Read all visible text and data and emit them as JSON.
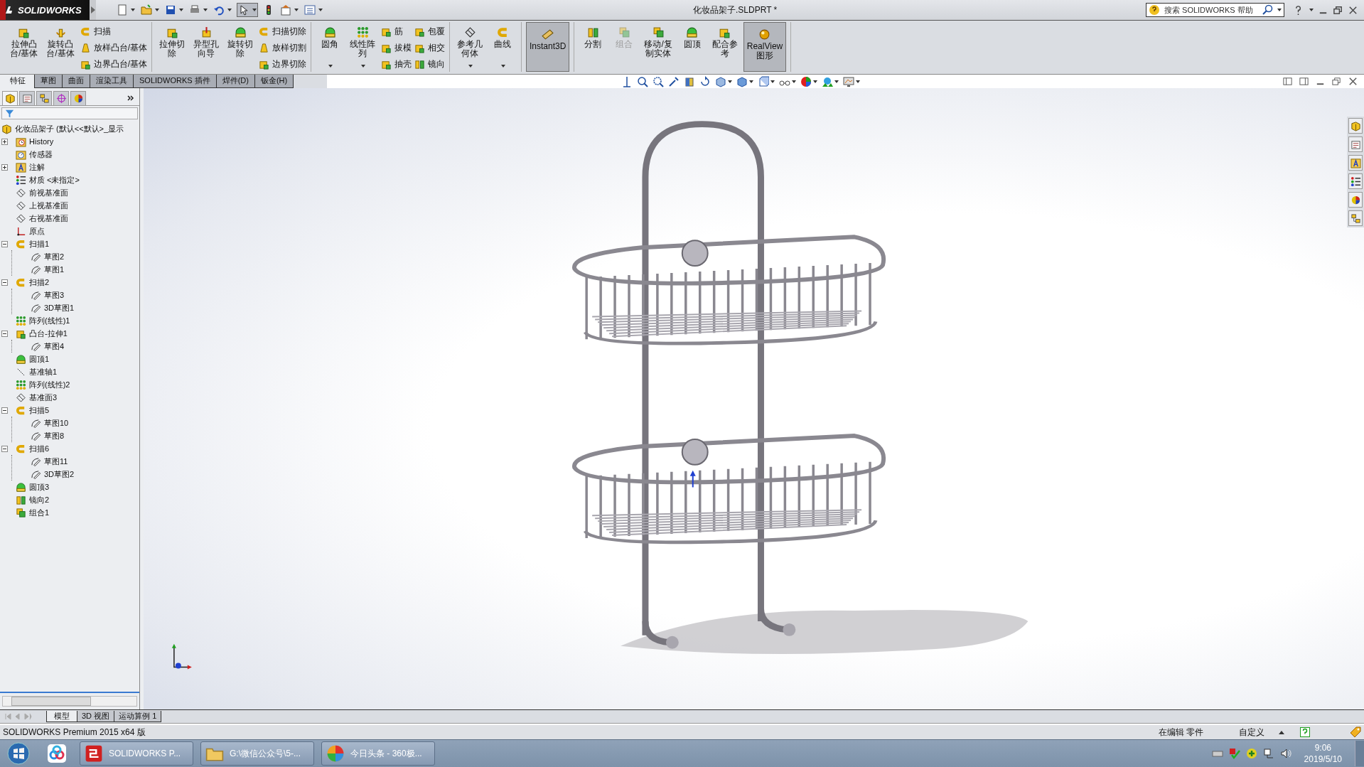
{
  "title_bar": {
    "brand": "SOLIDWORKS",
    "document_title": "化妆品架子.SLDPRT *",
    "search": {
      "placeholder": "搜索 SOLIDWORKS 帮助"
    }
  },
  "ribbon": {
    "groups": [
      [
        {
          "kind": "cube",
          "lines": [
            "拉伸凸",
            "台/基体"
          ],
          "selected": false,
          "disabled": false,
          "dropdown": false
        },
        {
          "kind": "revolve",
          "lines": [
            "旋转凸",
            "台/基体"
          ],
          "selected": false,
          "disabled": false,
          "dropdown": false
        },
        {
          "items": [
            {
              "label": "扫描",
              "kind": "sweep"
            },
            {
              "label": "放样凸台/基体",
              "kind": "bell"
            },
            {
              "label": "边界凸台/基体",
              "kind": "cube"
            }
          ]
        }
      ],
      [
        {
          "kind": "cube",
          "lines": [
            "拉伸切",
            "除"
          ],
          "selected": false,
          "disabled": false,
          "dropdown": false
        },
        {
          "kind": "drill",
          "lines": [
            "异型孔",
            "向导"
          ],
          "selected": false,
          "disabled": false,
          "dropdown": false
        },
        {
          "kind": "dome",
          "lines": [
            "旋转切",
            "除"
          ],
          "selected": false,
          "disabled": false,
          "dropdown": false
        },
        {
          "items": [
            {
              "label": "扫描切除",
              "kind": "sweep"
            },
            {
              "label": "放样切割",
              "kind": "bell"
            },
            {
              "label": "边界切除",
              "kind": "cube"
            }
          ]
        }
      ],
      [
        {
          "kind": "dome",
          "lines": [
            "圆角"
          ],
          "selected": false,
          "disabled": false,
          "dropdown": true
        },
        {
          "kind": "dots",
          "lines": [
            "线性阵",
            "列"
          ],
          "selected": false,
          "disabled": false,
          "dropdown": true
        },
        {
          "items": [
            {
              "label": "筋",
              "kind": "cube"
            },
            {
              "label": "拔模",
              "kind": "cube"
            },
            {
              "label": "抽壳",
              "kind": "cube"
            }
          ]
        },
        {
          "items": [
            {
              "label": "包覆",
              "kind": "cube"
            },
            {
              "label": "相交",
              "kind": "cube"
            },
            {
              "label": "镜向",
              "kind": "mirror"
            }
          ]
        }
      ],
      [
        {
          "kind": "plane",
          "lines": [
            "参考几",
            "何体"
          ],
          "selected": false,
          "disabled": false,
          "dropdown": true
        },
        {
          "kind": "sweep",
          "lines": [
            "曲线"
          ],
          "selected": false,
          "disabled": false,
          "dropdown": true
        }
      ],
      [
        {
          "kind": "ruler",
          "lines": [
            "Instant3D"
          ],
          "selected": true,
          "disabled": false,
          "dropdown": false
        }
      ],
      [
        {
          "kind": "mirror",
          "lines": [
            "分割"
          ],
          "selected": false,
          "disabled": false,
          "dropdown": false
        },
        {
          "kind": "combine",
          "lines": [
            "组合"
          ],
          "selected": false,
          "disabled": true,
          "dropdown": false
        },
        {
          "kind": "combine",
          "lines": [
            "移动/复",
            "制实体"
          ],
          "selected": false,
          "disabled": false,
          "dropdown": false
        },
        {
          "kind": "dome",
          "lines": [
            "圆顶"
          ],
          "selected": false,
          "disabled": false,
          "dropdown": false
        },
        {
          "kind": "cube",
          "lines": [
            "配合参",
            "考"
          ],
          "selected": false,
          "disabled": false,
          "dropdown": false
        },
        {
          "kind": "sphere",
          "lines": [
            "RealView",
            "图形"
          ],
          "selected": true,
          "disabled": false,
          "dropdown": false
        }
      ]
    ]
  },
  "command_tabs": [
    {
      "label": "特征",
      "selected": true
    },
    {
      "label": "草图",
      "selected": false
    },
    {
      "label": "曲面",
      "selected": false
    },
    {
      "label": "渲染工具",
      "selected": false
    },
    {
      "label": "SOLIDWORKS 插件",
      "selected": false
    },
    {
      "label": "焊件(D)",
      "selected": false
    },
    {
      "label": "钣金(H)",
      "selected": false
    }
  ],
  "panel_tabs": [
    {
      "kind": "part",
      "selected": true
    },
    {
      "kind": "property",
      "selected": false
    },
    {
      "kind": "config",
      "selected": false
    },
    {
      "kind": "target",
      "selected": false
    },
    {
      "kind": "pie",
      "selected": false
    }
  ],
  "feature_tree": {
    "root": {
      "label": "化妆品架子  (默认<<默认>_显示",
      "kind": "part"
    },
    "items": [
      {
        "label": "History",
        "kind": "history",
        "expanded": false
      },
      {
        "label": "传感器",
        "kind": "sensor"
      },
      {
        "label": "注解",
        "kind": "annotation",
        "expanded": false
      },
      {
        "label": "材质 <未指定>",
        "kind": "material"
      },
      {
        "label": "前视基准面",
        "kind": "plane"
      },
      {
        "label": "上视基准面",
        "kind": "plane"
      },
      {
        "label": "右视基准面",
        "kind": "plane"
      },
      {
        "label": "原点",
        "kind": "origin"
      },
      {
        "label": "扫描1",
        "kind": "sweep",
        "expanded": true,
        "children": [
          {
            "label": "草图2",
            "kind": "sketch"
          },
          {
            "label": "草图1",
            "kind": "sketch"
          }
        ]
      },
      {
        "label": "扫描2",
        "kind": "sweep",
        "expanded": true,
        "children": [
          {
            "label": "草图3",
            "kind": "sketch"
          },
          {
            "label": "3D草图1",
            "kind": "sketch"
          }
        ]
      },
      {
        "label": "阵列(线性)1",
        "kind": "dots"
      },
      {
        "label": "凸台-拉伸1",
        "kind": "cube",
        "expanded": true,
        "children": [
          {
            "label": "草图4",
            "kind": "sketch"
          }
        ]
      },
      {
        "label": "圆顶1",
        "kind": "dome"
      },
      {
        "label": "基准轴1",
        "kind": "axis"
      },
      {
        "label": "阵列(线性)2",
        "kind": "dots"
      },
      {
        "label": "基准面3",
        "kind": "plane"
      },
      {
        "label": "扫描5",
        "kind": "sweep",
        "expanded": true,
        "children": [
          {
            "label": "草图10",
            "kind": "sketch"
          },
          {
            "label": "草图8",
            "kind": "sketch"
          }
        ]
      },
      {
        "label": "扫描6",
        "kind": "sweep",
        "expanded": true,
        "children": [
          {
            "label": "草图11",
            "kind": "sketch"
          },
          {
            "label": "3D草图2",
            "kind": "sketch"
          }
        ]
      },
      {
        "label": "圆顶3",
        "kind": "dome"
      },
      {
        "label": "镜向2",
        "kind": "mirror"
      },
      {
        "label": "组合1",
        "kind": "combine"
      }
    ]
  },
  "model_tabs": [
    {
      "label": "模型",
      "selected": true
    },
    {
      "label": "3D 视图",
      "selected": false
    },
    {
      "label": "运动算例 1",
      "selected": false
    }
  ],
  "status_bar": {
    "product": "SOLIDWORKS Premium 2015 x64 版",
    "mode": "在编辑 零件",
    "units": "自定义"
  },
  "taskbar": {
    "items": [
      {
        "label": "SOLIDWORKS P...",
        "kind": "sw"
      },
      {
        "label": "G:\\微信公众号\\5-...",
        "kind": "folder"
      },
      {
        "label": "今日头条 - 360极...",
        "kind": "browser"
      }
    ],
    "time": "9:06",
    "date": "2019/5/10"
  }
}
